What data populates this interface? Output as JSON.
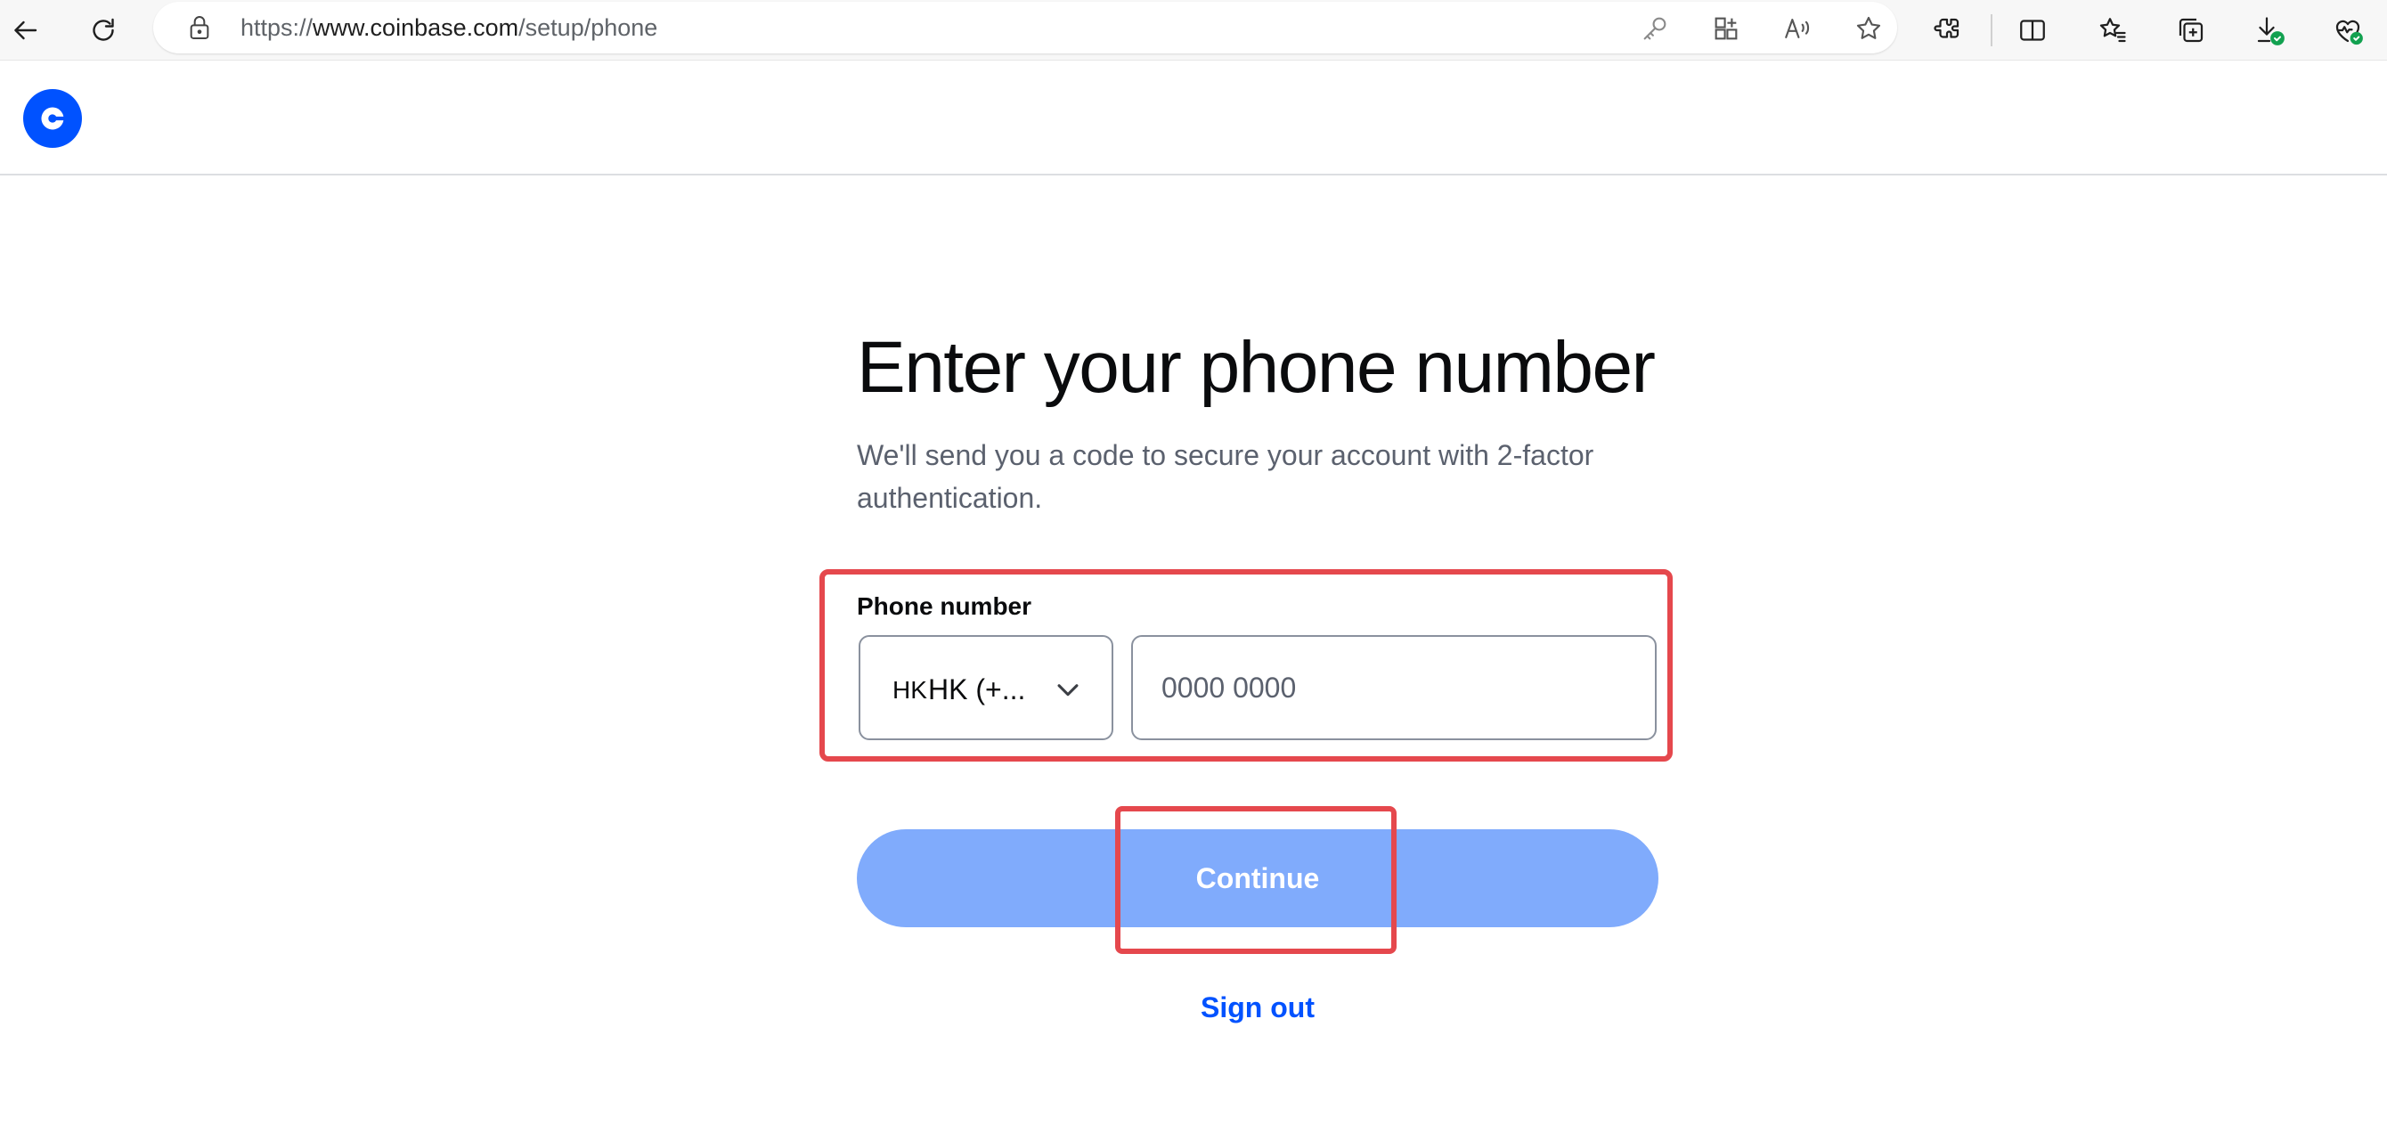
{
  "browser": {
    "url_prefix": "https://",
    "url_host": "www.coinbase.com",
    "url_path": "/setup/phone"
  },
  "icons": {
    "toolbar": [
      "back-arrow-icon",
      "refresh-icon",
      "lock-icon",
      "key-icon",
      "app-grid-icon",
      "read-aloud-icon",
      "favorite-star-icon",
      "extensions-icon",
      "split-screen-icon",
      "favorites-list-icon",
      "collections-icon",
      "download-icon",
      "browser-health-icon"
    ],
    "site": [
      "coinbase-logo"
    ]
  },
  "colors": {
    "brand_blue": "#0052ff",
    "continue_disabled": "#80abfc",
    "highlight_red": "#e5484d",
    "subtitle_gray": "#5b616e"
  },
  "page": {
    "title": "Enter your phone number",
    "subtitle": "We'll send you a code to secure your account with 2-factor authentication."
  },
  "form": {
    "phone_label": "Phone number",
    "country_flag": "HK",
    "country_value": "HK (+...",
    "phone_placeholder": "0000 0000",
    "continue_label": "Continue",
    "signout_label": "Sign out"
  }
}
